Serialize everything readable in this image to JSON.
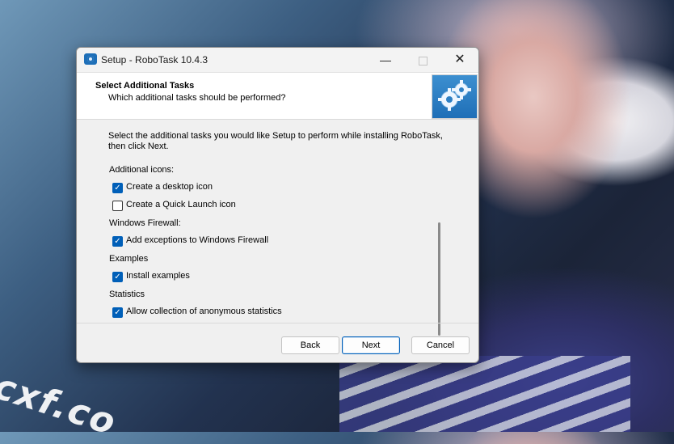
{
  "window": {
    "title": "Setup - RoboTask 10.4.3",
    "minimize_glyph": "—",
    "close_glyph": "✕"
  },
  "header": {
    "title": "Select Additional Tasks",
    "subtitle": "Which additional tasks should be performed?",
    "image_icon": "gears-icon"
  },
  "intro_text": "Select the additional tasks you would like Setup to perform while installing RoboTask, then click Next.",
  "task_groups": [
    {
      "label": "Additional icons:",
      "items": [
        {
          "label": "Create a desktop icon",
          "checked": true
        },
        {
          "label": "Create a Quick Launch icon",
          "checked": false
        }
      ]
    },
    {
      "label": "Windows Firewall:",
      "items": [
        {
          "label": "Add exceptions to Windows Firewall",
          "checked": true
        }
      ]
    },
    {
      "label": "Examples",
      "items": [
        {
          "label": "Install examples",
          "checked": true
        }
      ]
    },
    {
      "label": "Statistics",
      "items": [
        {
          "label": "Allow collection of anonymous statistics",
          "checked": true
        }
      ]
    }
  ],
  "buttons": {
    "back": "Back",
    "next": "Next",
    "cancel": "Cancel"
  },
  "background": {
    "watermark_text": "cxf.co"
  },
  "colors": {
    "accent": "#005fb8",
    "dialog_bg": "#f0f0f0",
    "header_bg": "#ffffff"
  }
}
